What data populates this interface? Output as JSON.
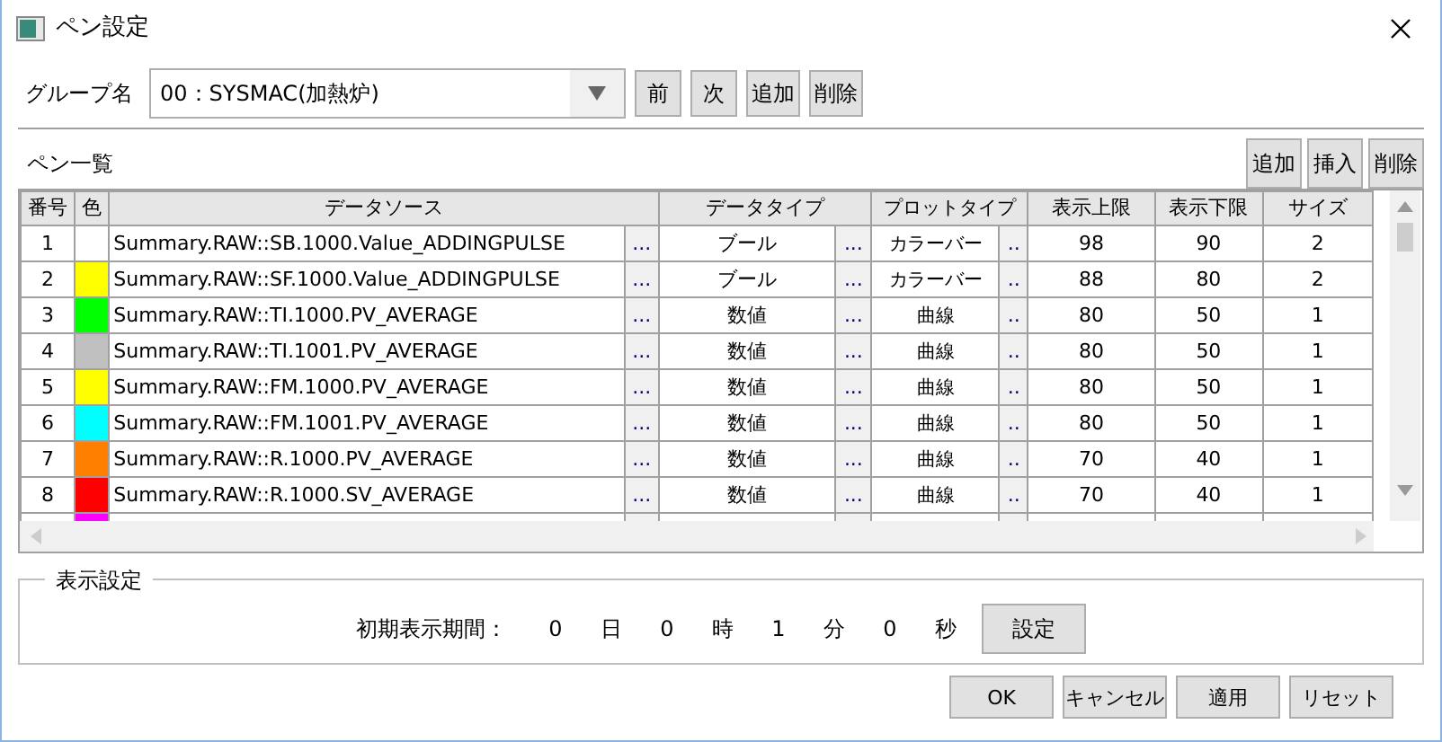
{
  "window": {
    "title": "ペン設定"
  },
  "group": {
    "label": "グループ名",
    "value": "00：SYSMAC(加熱炉)",
    "buttons": [
      "前",
      "次",
      "追加",
      "削除"
    ]
  },
  "pen_list": {
    "title": "ペン一覧",
    "buttons": [
      "追加",
      "挿入",
      "削除"
    ],
    "columns": [
      "番号",
      "色",
      "データソース",
      "データタイプ",
      "プロットタイプ",
      "表示上限",
      "表示下限",
      "サイズ"
    ],
    "rows": [
      {
        "no": "1",
        "color": "#ffffff",
        "source": "Summary.RAW::SB.1000.Value_ADDINGPULSE",
        "source_btn": "...",
        "type": "ブール",
        "type_btn": "...",
        "plot": "カラーバー",
        "plot_btn": "..",
        "upper": "98",
        "lower": "90",
        "size": "2"
      },
      {
        "no": "2",
        "color": "#ffff00",
        "source": "Summary.RAW::SF.1000.Value_ADDINGPULSE",
        "source_btn": "...",
        "type": "ブール",
        "type_btn": "...",
        "plot": "カラーバー",
        "plot_btn": "..",
        "upper": "88",
        "lower": "80",
        "size": "2"
      },
      {
        "no": "3",
        "color": "#00ff00",
        "source": "Summary.RAW::TI.1000.PV_AVERAGE",
        "source_btn": "...",
        "type": "数値",
        "type_btn": "...",
        "plot": "曲線",
        "plot_btn": "..",
        "upper": "80",
        "lower": "50",
        "size": "1"
      },
      {
        "no": "4",
        "color": "#c0c0c0",
        "source": "Summary.RAW::TI.1001.PV_AVERAGE",
        "source_btn": "...",
        "type": "数値",
        "type_btn": "...",
        "plot": "曲線",
        "plot_btn": "..",
        "upper": "80",
        "lower": "50",
        "size": "1"
      },
      {
        "no": "5",
        "color": "#ffff00",
        "source": "Summary.RAW::FM.1000.PV_AVERAGE",
        "source_btn": "...",
        "type": "数値",
        "type_btn": "...",
        "plot": "曲線",
        "plot_btn": "..",
        "upper": "80",
        "lower": "50",
        "size": "1"
      },
      {
        "no": "6",
        "color": "#00ffff",
        "source": "Summary.RAW::FM.1001.PV_AVERAGE",
        "source_btn": "...",
        "type": "数値",
        "type_btn": "...",
        "plot": "曲線",
        "plot_btn": "..",
        "upper": "80",
        "lower": "50",
        "size": "1"
      },
      {
        "no": "7",
        "color": "#ff8000",
        "source": "Summary.RAW::R.1000.PV_AVERAGE",
        "source_btn": "...",
        "type": "数値",
        "type_btn": "...",
        "plot": "曲線",
        "plot_btn": "..",
        "upper": "70",
        "lower": "40",
        "size": "1"
      },
      {
        "no": "8",
        "color": "#ff0000",
        "source": "Summary.RAW::R.1000.SV_AVERAGE",
        "source_btn": "...",
        "type": "数値",
        "type_btn": "...",
        "plot": "曲線",
        "plot_btn": "..",
        "upper": "70",
        "lower": "40",
        "size": "1"
      }
    ],
    "partial_row": {
      "color": "#ff00ff"
    }
  },
  "display": {
    "title": "表示設定",
    "label": "初期表示期間：",
    "parts": [
      {
        "value": "0",
        "unit": "日"
      },
      {
        "value": "0",
        "unit": "時"
      },
      {
        "value": "1",
        "unit": "分"
      },
      {
        "value": "0",
        "unit": "秒"
      }
    ],
    "button": "設定"
  },
  "footer_buttons": [
    "OK",
    "キャンセル",
    "適用",
    "リセット"
  ]
}
